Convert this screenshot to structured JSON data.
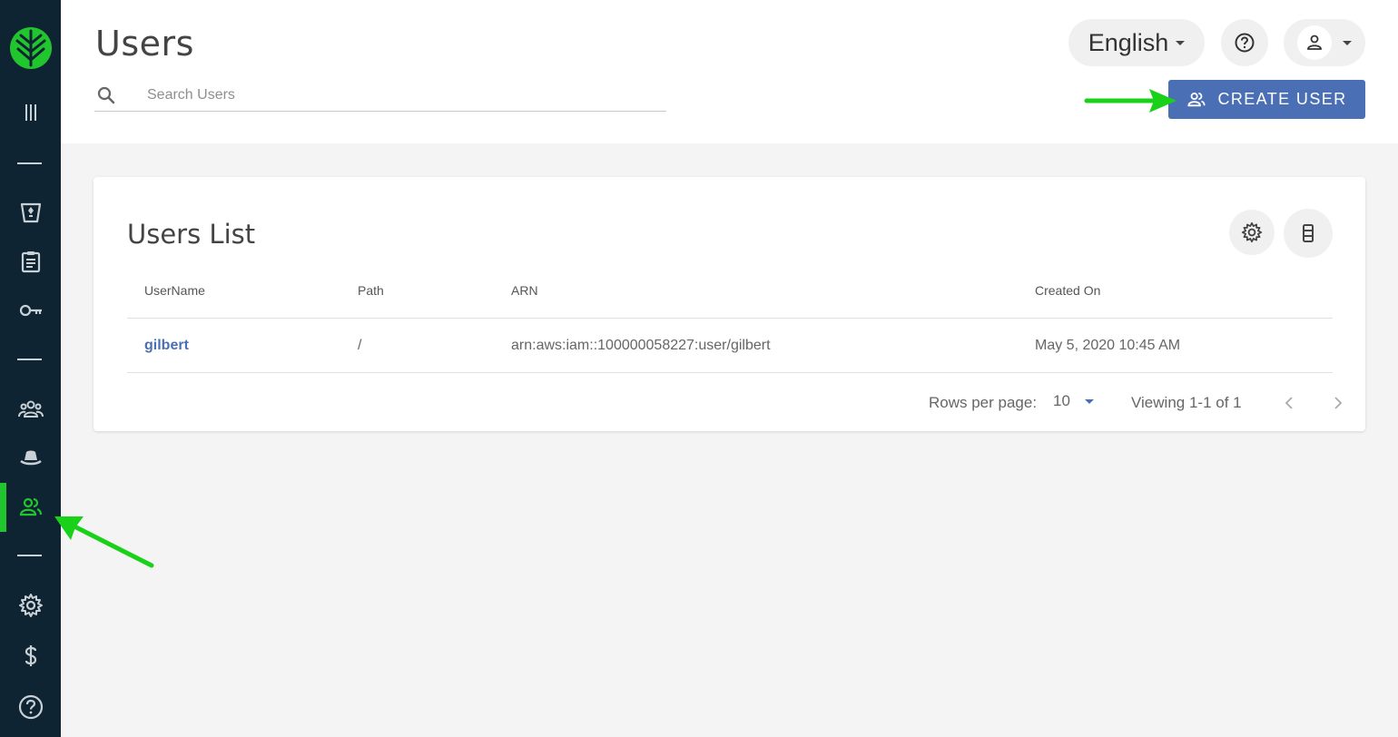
{
  "header": {
    "title": "Users",
    "search_placeholder": "Search Users",
    "language": "English",
    "create_label": "CREATE USER"
  },
  "sidebar": {
    "items": [
      "logo-icon",
      "menu-icon",
      "bucket-icon",
      "clipboard-icon",
      "key-icon",
      "groups-icon",
      "hat-icon",
      "users-icon",
      "settings-icon",
      "dollar-icon",
      "help-icon"
    ],
    "active": "users-icon"
  },
  "card": {
    "title": "Users List",
    "columns": [
      "UserName",
      "Path",
      "ARN",
      "Created On"
    ],
    "rows": [
      {
        "username": "gilbert",
        "path": "/",
        "arn": "arn:aws:iam::100000058227:user/gilbert",
        "created": "May 5, 2020 10:45 AM"
      }
    ]
  },
  "pager": {
    "rows_label": "Rows per page:",
    "rows_value": "10",
    "viewing": "Viewing 1-1 of 1"
  },
  "colors": {
    "sidebar_bg": "#0f2432",
    "accent_green": "#21c62e",
    "primary_blue": "#4b6fb5"
  }
}
